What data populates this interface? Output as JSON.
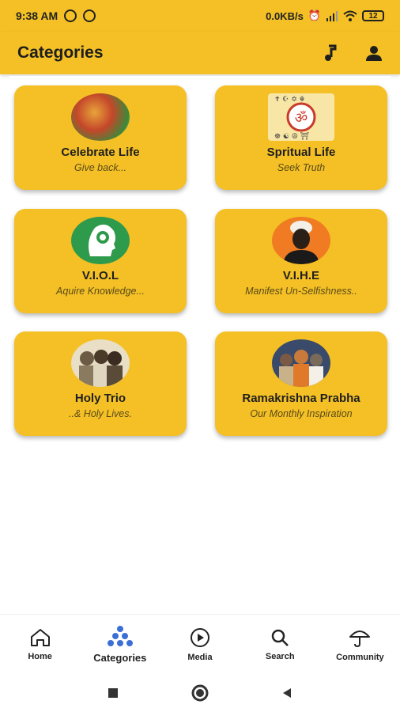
{
  "status_bar": {
    "time": "9:38 AM",
    "network_speed": "0.0KB/s",
    "battery": "12"
  },
  "app_bar": {
    "title": "Categories",
    "music_icon": "music-note-icon",
    "profile_icon": "person-icon"
  },
  "categories": [
    {
      "name": "Celebrate Life",
      "subtitle": "Give back..."
    },
    {
      "name": "Spritual Life",
      "subtitle": "Seek Truth"
    },
    {
      "name": "V.I.O.L",
      "subtitle": "Aquire Knowledge..."
    },
    {
      "name": "V.I.H.E",
      "subtitle": "Manifest Un-Selfishness.."
    },
    {
      "name": "Holy Trio",
      "subtitle": "..& Holy Lives."
    },
    {
      "name": "Ramakrishna Prabha",
      "subtitle": "Our Monthly Inspiration"
    }
  ],
  "bottom_nav": [
    {
      "label": "Home",
      "icon": "home-icon"
    },
    {
      "label": "Categories",
      "icon": "categories-icon"
    },
    {
      "label": "Media",
      "icon": "play-icon"
    },
    {
      "label": "Search",
      "icon": "search-icon"
    },
    {
      "label": "Community",
      "icon": "umbrella-icon"
    }
  ],
  "colors": {
    "accent": "#f4c025",
    "active_nav": "#3b6fd6"
  }
}
